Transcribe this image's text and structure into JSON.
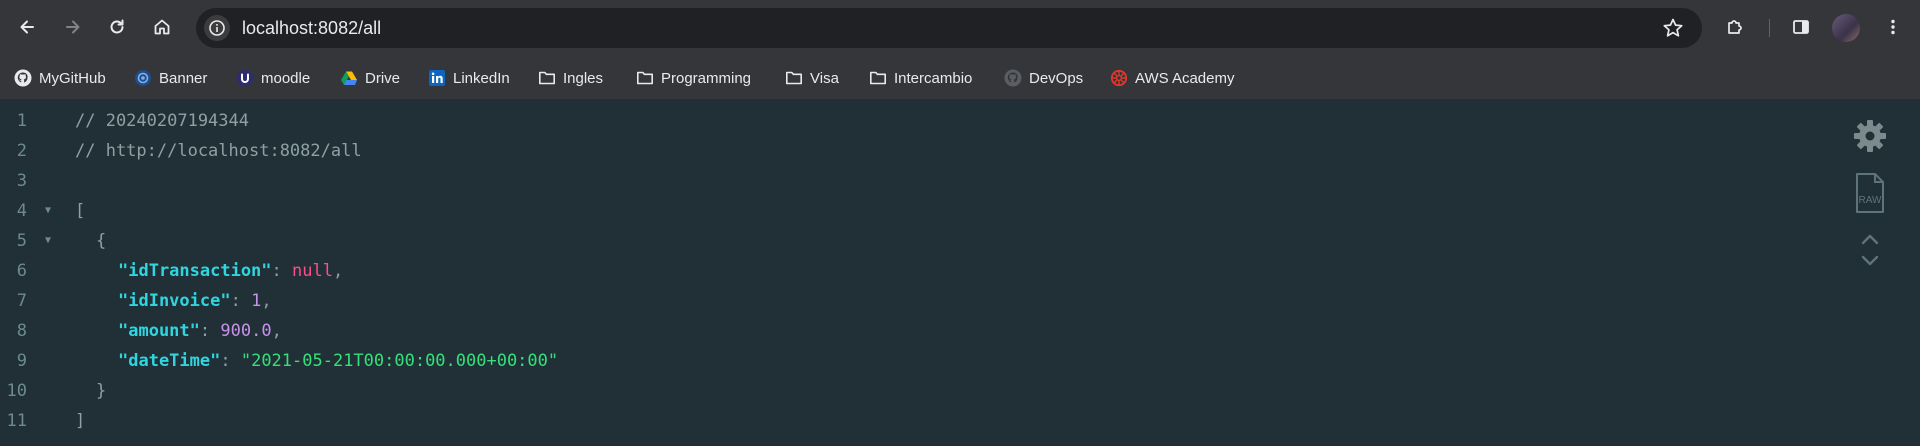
{
  "browser": {
    "url": "localhost:8082/all"
  },
  "bookmarks": [
    {
      "label": "MyGitHub",
      "icon": "github-icon"
    },
    {
      "label": "Banner",
      "icon": "banner-icon"
    },
    {
      "label": "moodle",
      "icon": "moodle-icon"
    },
    {
      "label": "Drive",
      "icon": "drive-icon"
    },
    {
      "label": "LinkedIn",
      "icon": "linkedin-icon"
    },
    {
      "label": "Ingles",
      "icon": "folder-icon"
    },
    {
      "label": "Programming",
      "icon": "folder-icon"
    },
    {
      "label": "Visa",
      "icon": "folder-icon"
    },
    {
      "label": "Intercambio",
      "icon": "folder-icon"
    },
    {
      "label": "DevOps",
      "icon": "github-icon"
    },
    {
      "label": "AWS Academy",
      "icon": "aws-academy-icon"
    }
  ],
  "json_viewer": {
    "line_numbers": [
      "1",
      "2",
      "3",
      "4",
      "5",
      "6",
      "7",
      "8",
      "9",
      "10",
      "11"
    ],
    "comment_timestamp": "// 20240207194344",
    "comment_url": "// http://localhost:8082/all",
    "open_bracket": "[",
    "open_brace": "{",
    "close_brace": "}",
    "close_bracket": "]",
    "fields": [
      {
        "key": "\"idTransaction\"",
        "value": "null",
        "type": "null",
        "trail": ","
      },
      {
        "key": "\"idInvoice\"",
        "value": "1",
        "type": "num",
        "trail": ","
      },
      {
        "key": "\"amount\"",
        "value": "900.0",
        "type": "num",
        "trail": ","
      },
      {
        "key": "\"dateTime\"",
        "value": "\"2021-05-21T00:00:00.000+00:00\"",
        "type": "str",
        "trail": ""
      }
    ],
    "raw_label": "RAW"
  },
  "colors": {
    "viewer_bg": "#203036",
    "key": "#2fd6e0",
    "null": "#ff4d8b",
    "number": "#c792ea",
    "string": "#34e07a"
  }
}
